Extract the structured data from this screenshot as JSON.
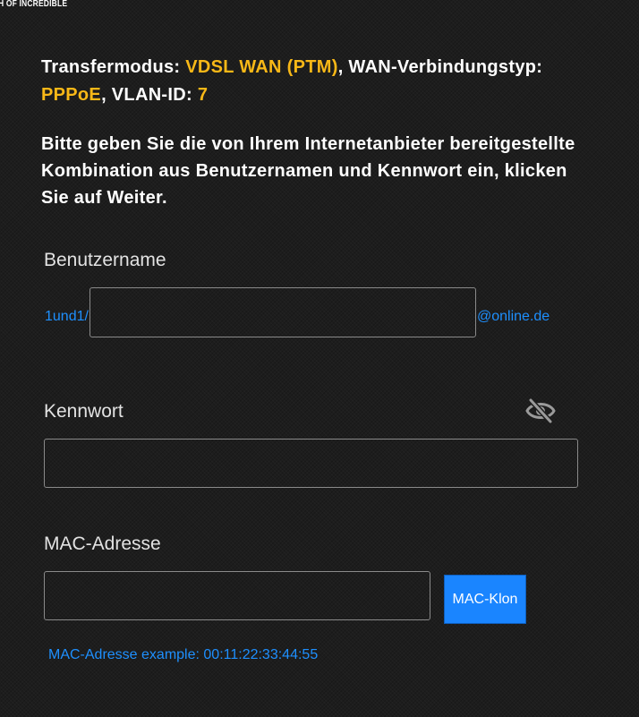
{
  "header": {
    "tagline": "H OF INCREDIBLE"
  },
  "info": {
    "transfer_label": "Transfermodus: ",
    "transfer_value": "VDSL WAN (PTM)",
    "wan_label": ", WAN-Verbindungstyp: ",
    "wan_value": "PPPoE",
    "vlan_label": ", VLAN-ID: ",
    "vlan_value": "7"
  },
  "instructions": "Bitte geben Sie die von Ihrem Internetanbieter bereitgestellte Kombination aus Benutzernamen und Kennwort ein, klicken Sie auf Weiter.",
  "username": {
    "label": "Benutzername",
    "prefix": "1und1/",
    "suffix": "@online.de",
    "value": ""
  },
  "password": {
    "label": "Kennwort",
    "value": "",
    "toggle_icon": "eye-slash-icon"
  },
  "mac": {
    "label": "MAC-Adresse",
    "value": "",
    "clone_button": "MAC-Klon",
    "hint": "MAC-Adresse example: 00:11:22:33:44:55"
  },
  "colors": {
    "background": "#1d1d1d",
    "highlight": "#f8b817",
    "link": "#1e90ff",
    "button": "#1a85ff"
  }
}
